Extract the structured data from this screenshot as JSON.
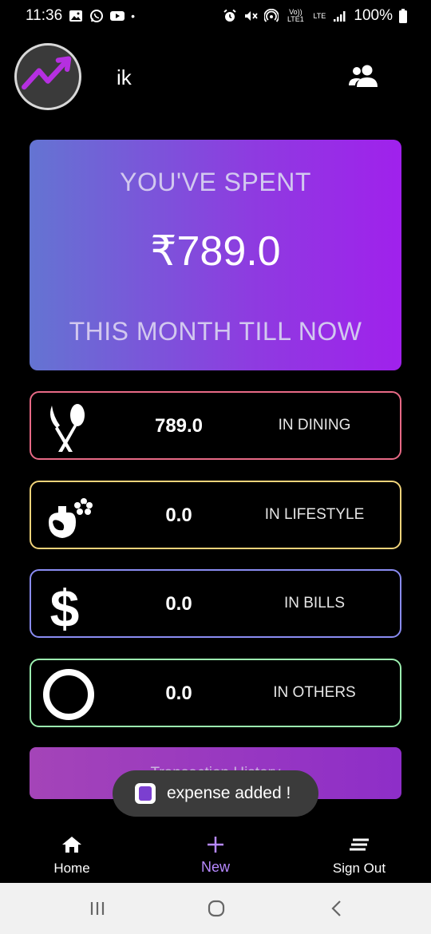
{
  "status_bar": {
    "time": "11:36",
    "battery": "100%",
    "network_tiny": "Vo)) LTE1",
    "lte": "LTE"
  },
  "header": {
    "username": "ik"
  },
  "summary": {
    "title": "YOU'VE SPENT",
    "amount": "₹789.0",
    "subtitle": "THIS MONTH TILL NOW"
  },
  "categories": [
    {
      "amount": "789.0",
      "label": "IN DINING",
      "color": "#e86a86",
      "icon": "fork-spoon-icon"
    },
    {
      "amount": "0.0",
      "label": "IN LIFESTYLE",
      "color": "#f0d37a",
      "icon": "perfume-flower-icon"
    },
    {
      "amount": "0.0",
      "label": "IN BILLS",
      "color": "#8a8cf2",
      "icon": "dollar-icon"
    },
    {
      "amount": "0.0",
      "label": "IN OTHERS",
      "color": "#9cf0b0",
      "icon": "circle-icon"
    }
  ],
  "history_button": {
    "label": "Transaction History"
  },
  "toast": {
    "message": "expense added !"
  },
  "bottom_nav": [
    {
      "label": "Home",
      "icon": "home-icon"
    },
    {
      "label": "New",
      "icon": "plus-icon",
      "active": true
    },
    {
      "label": "Sign Out",
      "icon": "menu-icon"
    }
  ],
  "accent_color": "#b789ff"
}
